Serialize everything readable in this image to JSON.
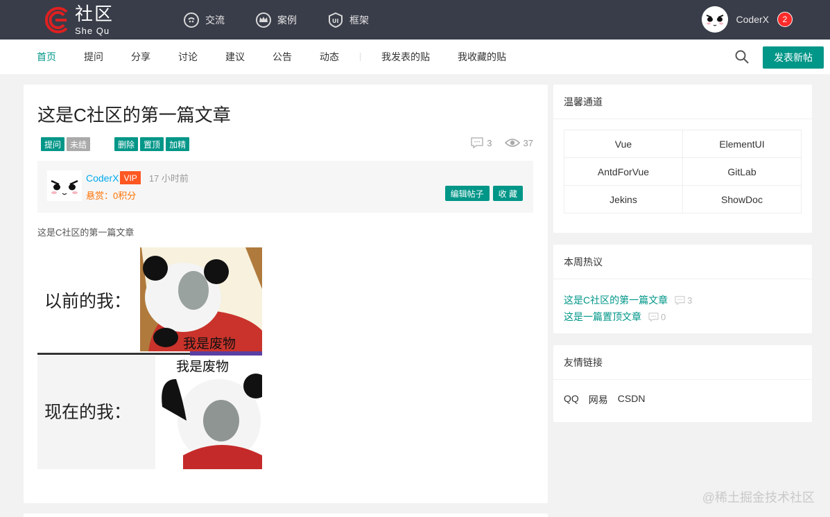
{
  "brand": {
    "cn": "社区",
    "en": "She Qu",
    "color": "#e02020"
  },
  "topnav": [
    {
      "label": "交流",
      "icon": "chat-icon"
    },
    {
      "label": "案例",
      "icon": "crown-icon"
    },
    {
      "label": "框架",
      "icon": "ui-shield-icon"
    }
  ],
  "user": {
    "name": "CoderX",
    "notifications": "2"
  },
  "subnav": {
    "items": [
      "首页",
      "提问",
      "分享",
      "讨论",
      "建议",
      "公告",
      "动态"
    ],
    "mine": [
      "我发表的贴",
      "我收藏的贴"
    ],
    "post_button": "发表新帖",
    "active_color": "#009688"
  },
  "article": {
    "title": "这是C社区的第一篇文章",
    "tags": [
      "提问",
      "未结"
    ],
    "admin_tags": [
      "删除",
      "置顶",
      "加精"
    ],
    "comments": "3",
    "views": "37",
    "author": "CoderX",
    "vip": "VIP",
    "time": "17 小时前",
    "reward": "悬赏：0积分",
    "edit_button": "编辑帖子",
    "favorite_button": "收 藏",
    "body": "这是C社区的第一篇文章",
    "meme": {
      "top_text": "以前的我：",
      "top_caption": "我是废物",
      "bottom_text": "现在的我：",
      "bottom_caption": "我是废物"
    }
  },
  "sidebar": {
    "channels": {
      "title": "温馨通道",
      "items": [
        "Vue",
        "ElementUI",
        "AntdForVue",
        "GitLab",
        "Jekins",
        "ShowDoc"
      ]
    },
    "hot": {
      "title": "本周热议",
      "items": [
        {
          "title": "这是C社区的第一篇文章",
          "count": "3"
        },
        {
          "title": "这是一篇置顶文章",
          "count": "0"
        }
      ]
    },
    "friends": {
      "title": "友情链接",
      "items": [
        "QQ",
        "网易",
        "CSDN"
      ]
    }
  },
  "watermark": "@稀土掘金技术社区"
}
